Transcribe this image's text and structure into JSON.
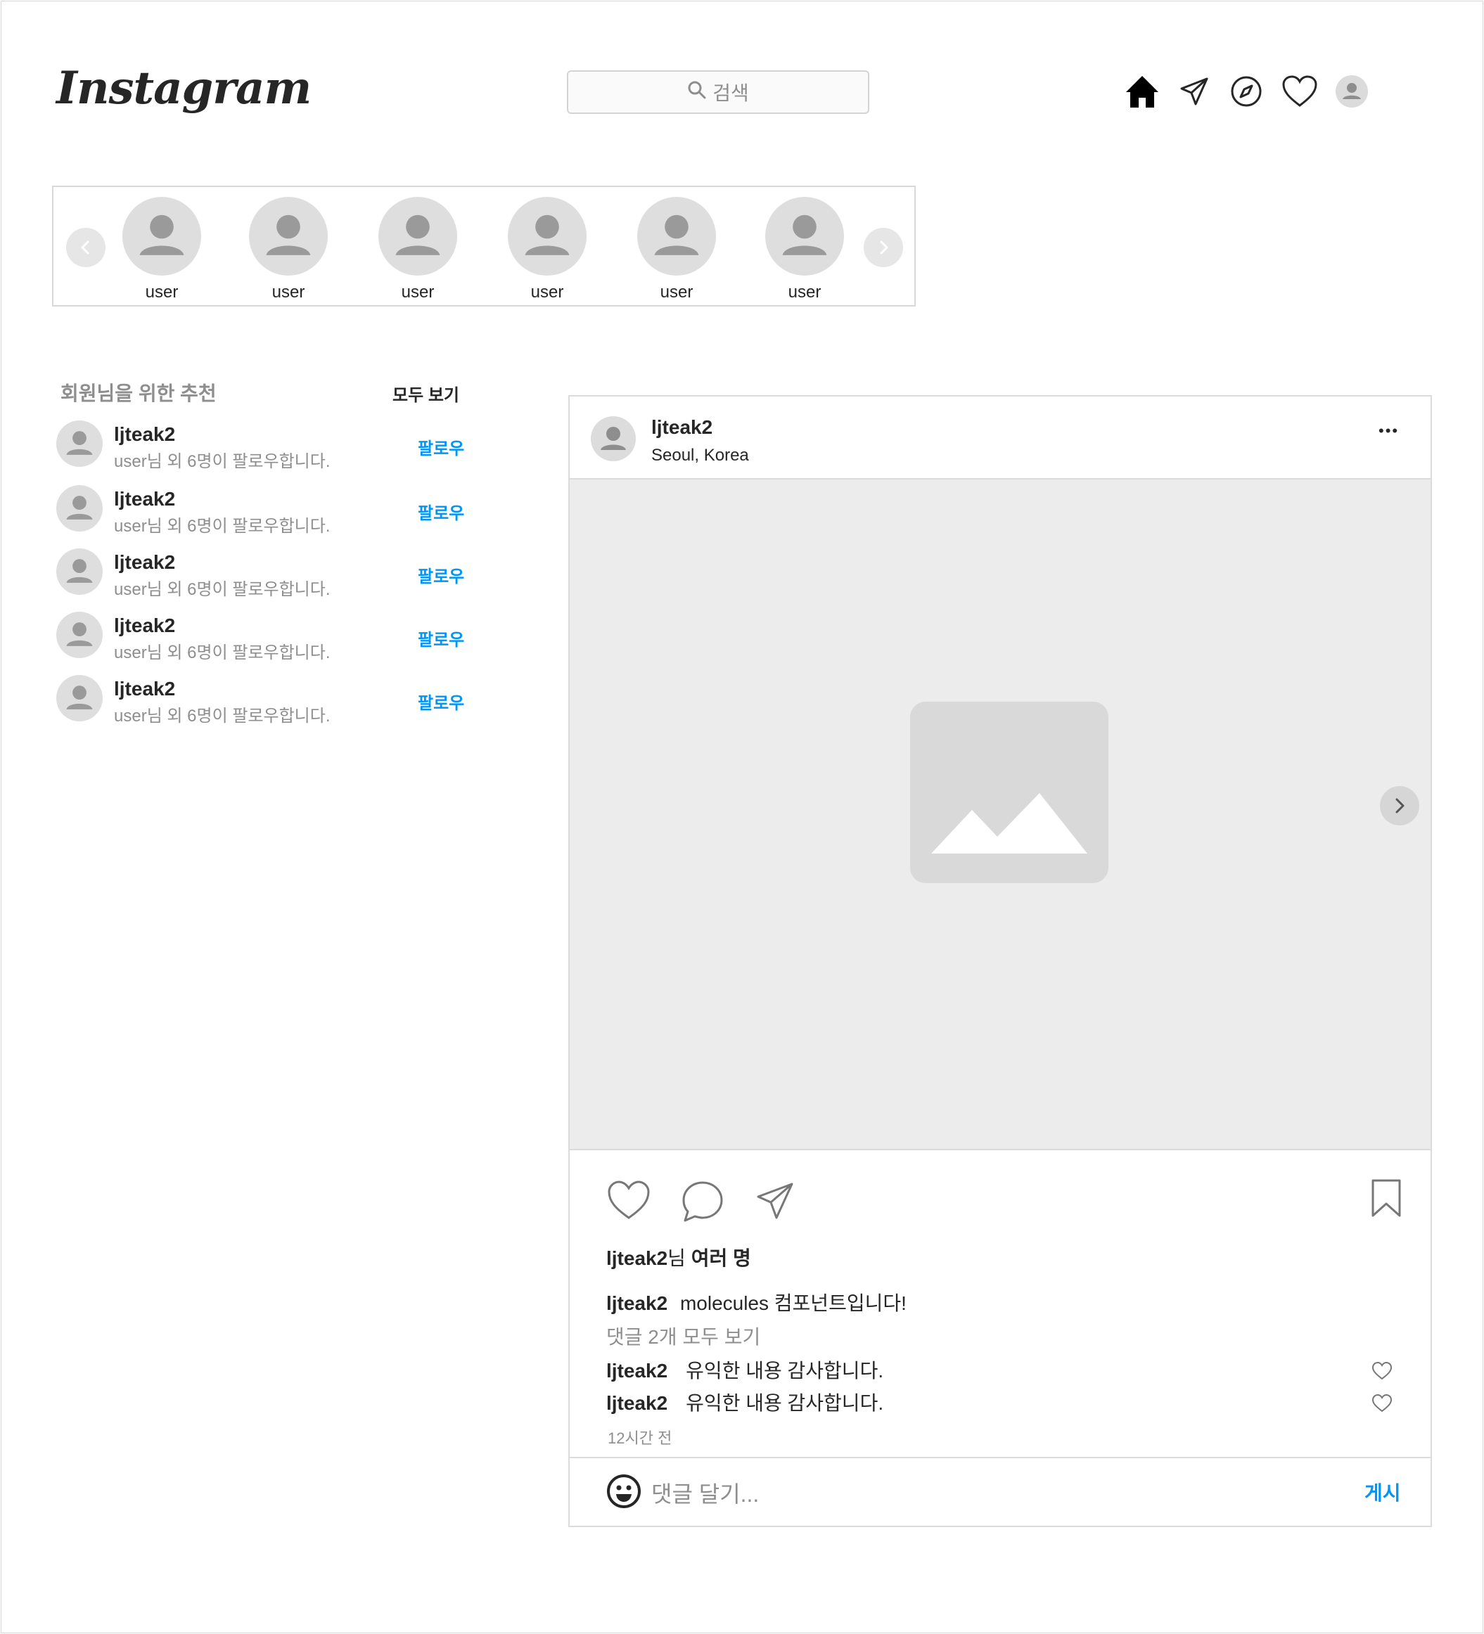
{
  "header": {
    "logo": "Instagram",
    "search_placeholder": "검색",
    "nav_icons": [
      "home-icon",
      "direct-icon",
      "explore-icon",
      "activity-heart-icon",
      "profile-icon"
    ]
  },
  "stories": {
    "items": [
      {
        "label": "user"
      },
      {
        "label": "user"
      },
      {
        "label": "user"
      },
      {
        "label": "user"
      },
      {
        "label": "user"
      },
      {
        "label": "user"
      }
    ]
  },
  "recommendations": {
    "title": "회원님을 위한 추천",
    "see_all": "모두 보기",
    "items": [
      {
        "name": "ljteak2",
        "sub": "user님 외 6명이 팔로우합니다.",
        "action": "팔로우"
      },
      {
        "name": "ljteak2",
        "sub": "user님 외 6명이 팔로우합니다.",
        "action": "팔로우"
      },
      {
        "name": "ljteak2",
        "sub": "user님 외 6명이 팔로우합니다.",
        "action": "팔로우"
      },
      {
        "name": "ljteak2",
        "sub": "user님 외 6명이 팔로우합니다.",
        "action": "팔로우"
      },
      {
        "name": "ljteak2",
        "sub": "user님 외 6명이 팔로우합니다.",
        "action": "팔로우"
      }
    ]
  },
  "post": {
    "username": "ljteak2",
    "location": "Seoul, Korea",
    "more": "•••",
    "likes_user": "ljteak2",
    "likes_mid": "님",
    "likes_rest": "여러 명",
    "caption_user": "ljteak2",
    "caption_text": "molecules 컴포넌트입니다!",
    "view_comments": "댓글 2개 모두 보기",
    "comments": [
      {
        "user": "ljteak2",
        "text": "유익한 내용 감사합니다."
      },
      {
        "user": "ljteak2",
        "text": "유익한 내용 감사합니다."
      }
    ],
    "time": "12시간 전",
    "comment_placeholder": "댓글 달기...",
    "post_button": "게시"
  },
  "colors": {
    "accent": "#0095f6",
    "border": "#dbdbdb",
    "placeholder_gray": "#d9d9d9",
    "image_bg": "#ececec"
  }
}
